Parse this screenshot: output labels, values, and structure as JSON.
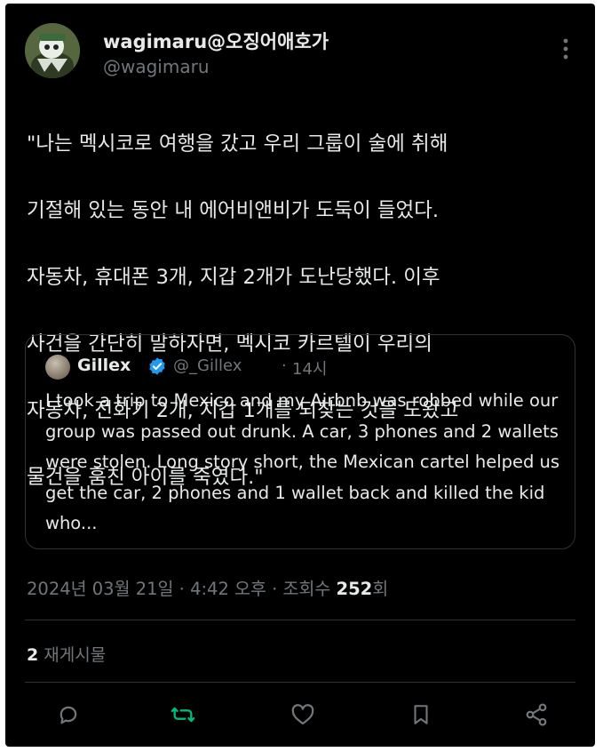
{
  "tweet": {
    "display_name": "wagimaru@오징어애호가",
    "handle": "@wagimaru",
    "text_lines": [
      "\"나는 멕시코로 여행을 갔고 우리 그룹이 술에 취해",
      "기절해 있는 동안 내 에어비앤비가 도둑이 들었다.",
      "자동차, 휴대폰 3개, 지갑 2개가 도난당했다. 이후",
      "사건을 간단히 말하자면, 멕시코 카르텔이 우리의",
      "자동차, 전화기 2개, 지갑 1개를 되찾는 것을 도왔고",
      "물건을 훔친 아이를 죽였다.\""
    ],
    "date_time": "2024년 03월 21일 · 4:42 오후 · 조회수 ",
    "views": "252",
    "views_suffix": "회",
    "repost_count": "2",
    "repost_label": "재게시물"
  },
  "quoted": {
    "display_name": "Gillex",
    "handle": "@_Gillex",
    "separator": "·",
    "time": "14시",
    "text": "I took a trip to Mexico and my Airbnb was robbed while our group was passed out drunk. A car, 3 phones and 2 wallets were stolen. Long story short, the Mexican cartel helped us get the car, 2 phones and 1 wallet back and killed the kid who..."
  },
  "icons": {
    "more": "more-vertical-icon",
    "verified": "verified-badge-icon",
    "reply": "reply-icon",
    "repost": "repost-icon",
    "like": "heart-icon",
    "bookmark": "bookmark-icon",
    "share": "share-icon"
  },
  "colors": {
    "background": "#000000",
    "primary_text": "#e7e9ea",
    "secondary_text": "#71767b",
    "verified_blue": "#1d9bf0",
    "repost_green": "#00ba7c",
    "border": "#2f3336"
  }
}
